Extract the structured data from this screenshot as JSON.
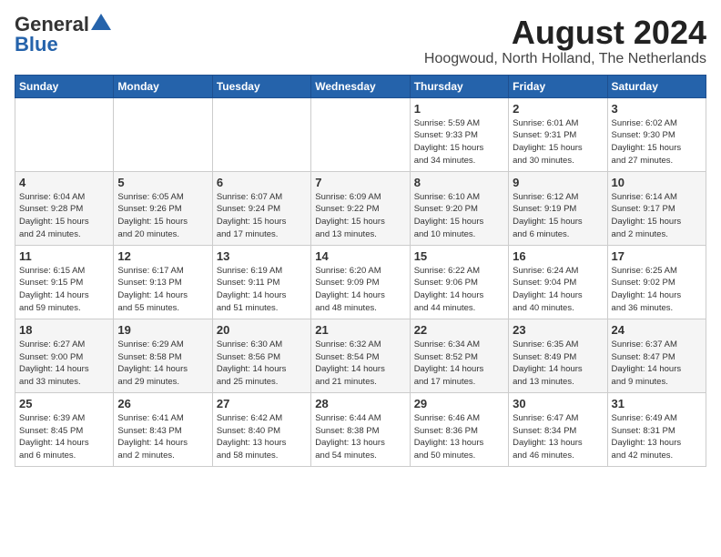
{
  "header": {
    "logo_line1": "General",
    "logo_line2": "Blue",
    "title": "August 2024",
    "subtitle": "Hoogwoud, North Holland, The Netherlands"
  },
  "weekdays": [
    "Sunday",
    "Monday",
    "Tuesday",
    "Wednesday",
    "Thursday",
    "Friday",
    "Saturday"
  ],
  "weeks": [
    [
      {
        "day": "",
        "info": ""
      },
      {
        "day": "",
        "info": ""
      },
      {
        "day": "",
        "info": ""
      },
      {
        "day": "",
        "info": ""
      },
      {
        "day": "1",
        "info": "Sunrise: 5:59 AM\nSunset: 9:33 PM\nDaylight: 15 hours\nand 34 minutes."
      },
      {
        "day": "2",
        "info": "Sunrise: 6:01 AM\nSunset: 9:31 PM\nDaylight: 15 hours\nand 30 minutes."
      },
      {
        "day": "3",
        "info": "Sunrise: 6:02 AM\nSunset: 9:30 PM\nDaylight: 15 hours\nand 27 minutes."
      }
    ],
    [
      {
        "day": "4",
        "info": "Sunrise: 6:04 AM\nSunset: 9:28 PM\nDaylight: 15 hours\nand 24 minutes."
      },
      {
        "day": "5",
        "info": "Sunrise: 6:05 AM\nSunset: 9:26 PM\nDaylight: 15 hours\nand 20 minutes."
      },
      {
        "day": "6",
        "info": "Sunrise: 6:07 AM\nSunset: 9:24 PM\nDaylight: 15 hours\nand 17 minutes."
      },
      {
        "day": "7",
        "info": "Sunrise: 6:09 AM\nSunset: 9:22 PM\nDaylight: 15 hours\nand 13 minutes."
      },
      {
        "day": "8",
        "info": "Sunrise: 6:10 AM\nSunset: 9:20 PM\nDaylight: 15 hours\nand 10 minutes."
      },
      {
        "day": "9",
        "info": "Sunrise: 6:12 AM\nSunset: 9:19 PM\nDaylight: 15 hours\nand 6 minutes."
      },
      {
        "day": "10",
        "info": "Sunrise: 6:14 AM\nSunset: 9:17 PM\nDaylight: 15 hours\nand 2 minutes."
      }
    ],
    [
      {
        "day": "11",
        "info": "Sunrise: 6:15 AM\nSunset: 9:15 PM\nDaylight: 14 hours\nand 59 minutes."
      },
      {
        "day": "12",
        "info": "Sunrise: 6:17 AM\nSunset: 9:13 PM\nDaylight: 14 hours\nand 55 minutes."
      },
      {
        "day": "13",
        "info": "Sunrise: 6:19 AM\nSunset: 9:11 PM\nDaylight: 14 hours\nand 51 minutes."
      },
      {
        "day": "14",
        "info": "Sunrise: 6:20 AM\nSunset: 9:09 PM\nDaylight: 14 hours\nand 48 minutes."
      },
      {
        "day": "15",
        "info": "Sunrise: 6:22 AM\nSunset: 9:06 PM\nDaylight: 14 hours\nand 44 minutes."
      },
      {
        "day": "16",
        "info": "Sunrise: 6:24 AM\nSunset: 9:04 PM\nDaylight: 14 hours\nand 40 minutes."
      },
      {
        "day": "17",
        "info": "Sunrise: 6:25 AM\nSunset: 9:02 PM\nDaylight: 14 hours\nand 36 minutes."
      }
    ],
    [
      {
        "day": "18",
        "info": "Sunrise: 6:27 AM\nSunset: 9:00 PM\nDaylight: 14 hours\nand 33 minutes."
      },
      {
        "day": "19",
        "info": "Sunrise: 6:29 AM\nSunset: 8:58 PM\nDaylight: 14 hours\nand 29 minutes."
      },
      {
        "day": "20",
        "info": "Sunrise: 6:30 AM\nSunset: 8:56 PM\nDaylight: 14 hours\nand 25 minutes."
      },
      {
        "day": "21",
        "info": "Sunrise: 6:32 AM\nSunset: 8:54 PM\nDaylight: 14 hours\nand 21 minutes."
      },
      {
        "day": "22",
        "info": "Sunrise: 6:34 AM\nSunset: 8:52 PM\nDaylight: 14 hours\nand 17 minutes."
      },
      {
        "day": "23",
        "info": "Sunrise: 6:35 AM\nSunset: 8:49 PM\nDaylight: 14 hours\nand 13 minutes."
      },
      {
        "day": "24",
        "info": "Sunrise: 6:37 AM\nSunset: 8:47 PM\nDaylight: 14 hours\nand 9 minutes."
      }
    ],
    [
      {
        "day": "25",
        "info": "Sunrise: 6:39 AM\nSunset: 8:45 PM\nDaylight: 14 hours\nand 6 minutes."
      },
      {
        "day": "26",
        "info": "Sunrise: 6:41 AM\nSunset: 8:43 PM\nDaylight: 14 hours\nand 2 minutes."
      },
      {
        "day": "27",
        "info": "Sunrise: 6:42 AM\nSunset: 8:40 PM\nDaylight: 13 hours\nand 58 minutes."
      },
      {
        "day": "28",
        "info": "Sunrise: 6:44 AM\nSunset: 8:38 PM\nDaylight: 13 hours\nand 54 minutes."
      },
      {
        "day": "29",
        "info": "Sunrise: 6:46 AM\nSunset: 8:36 PM\nDaylight: 13 hours\nand 50 minutes."
      },
      {
        "day": "30",
        "info": "Sunrise: 6:47 AM\nSunset: 8:34 PM\nDaylight: 13 hours\nand 46 minutes."
      },
      {
        "day": "31",
        "info": "Sunrise: 6:49 AM\nSunset: 8:31 PM\nDaylight: 13 hours\nand 42 minutes."
      }
    ]
  ]
}
